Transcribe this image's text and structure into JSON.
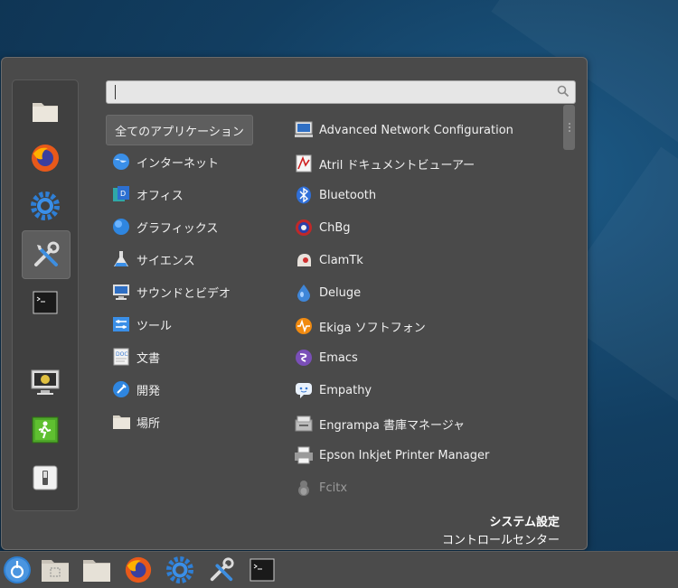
{
  "search": {
    "value": "",
    "placeholder": ""
  },
  "favorites": [
    {
      "name": "folder-icon"
    },
    {
      "name": "firefox-icon"
    },
    {
      "name": "settings-gear-icon"
    },
    {
      "name": "tools-icon",
      "active": true
    },
    {
      "name": "terminal-icon"
    },
    {
      "name": "lock-screen-icon"
    },
    {
      "name": "logout-icon"
    },
    {
      "name": "shutdown-icon"
    }
  ],
  "categories": [
    {
      "label": "全てのアプリケーション",
      "selected": true
    },
    {
      "label": "インターネット",
      "icon": "globe-icon"
    },
    {
      "label": "オフィス",
      "icon": "office-icon"
    },
    {
      "label": "グラフィックス",
      "icon": "graphics-icon"
    },
    {
      "label": "サイエンス",
      "icon": "flask-icon"
    },
    {
      "label": "サウンドとビデオ",
      "icon": "multimedia-icon"
    },
    {
      "label": "ツール",
      "icon": "utilities-icon"
    },
    {
      "label": "文書",
      "icon": "document-icon"
    },
    {
      "label": "開発",
      "icon": "development-icon"
    },
    {
      "label": "場所",
      "icon": "places-folder-icon"
    }
  ],
  "apps": [
    {
      "label": "Advanced Network Configuration",
      "icon": "network-config-icon"
    },
    {
      "label": "Atril ドキュメントビューアー",
      "icon": "atril-icon"
    },
    {
      "label": "Bluetooth",
      "icon": "bluetooth-icon"
    },
    {
      "label": "ChBg",
      "icon": "chbg-icon"
    },
    {
      "label": "ClamTk",
      "icon": "clamtk-icon"
    },
    {
      "label": "Deluge",
      "icon": "deluge-icon"
    },
    {
      "label": "Ekiga ソフトフォン",
      "icon": "ekiga-icon"
    },
    {
      "label": "Emacs",
      "icon": "emacs-icon"
    },
    {
      "label": "Empathy",
      "icon": "empathy-icon"
    },
    {
      "label": "Engrampa 書庫マネージャ",
      "icon": "engrampa-icon"
    },
    {
      "label": "Epson Inkjet Printer Manager",
      "icon": "printer-icon"
    },
    {
      "label": "Fcitx",
      "icon": "fcitx-icon",
      "dim": true
    }
  ],
  "footer": {
    "title": "システム設定",
    "subtitle": "コントロールセンター"
  },
  "taskbar": [
    {
      "name": "menu-launcher-icon"
    },
    {
      "name": "show-desktop-icon"
    },
    {
      "name": "files-folder-icon"
    },
    {
      "name": "firefox-icon"
    },
    {
      "name": "settings-gear-icon"
    },
    {
      "name": "tools-icon"
    },
    {
      "name": "terminal-icon"
    }
  ],
  "colors": {
    "menu_bg": "#4a4a4a",
    "panel_bg": "#4b4b4b",
    "desktop": "#123e61"
  }
}
